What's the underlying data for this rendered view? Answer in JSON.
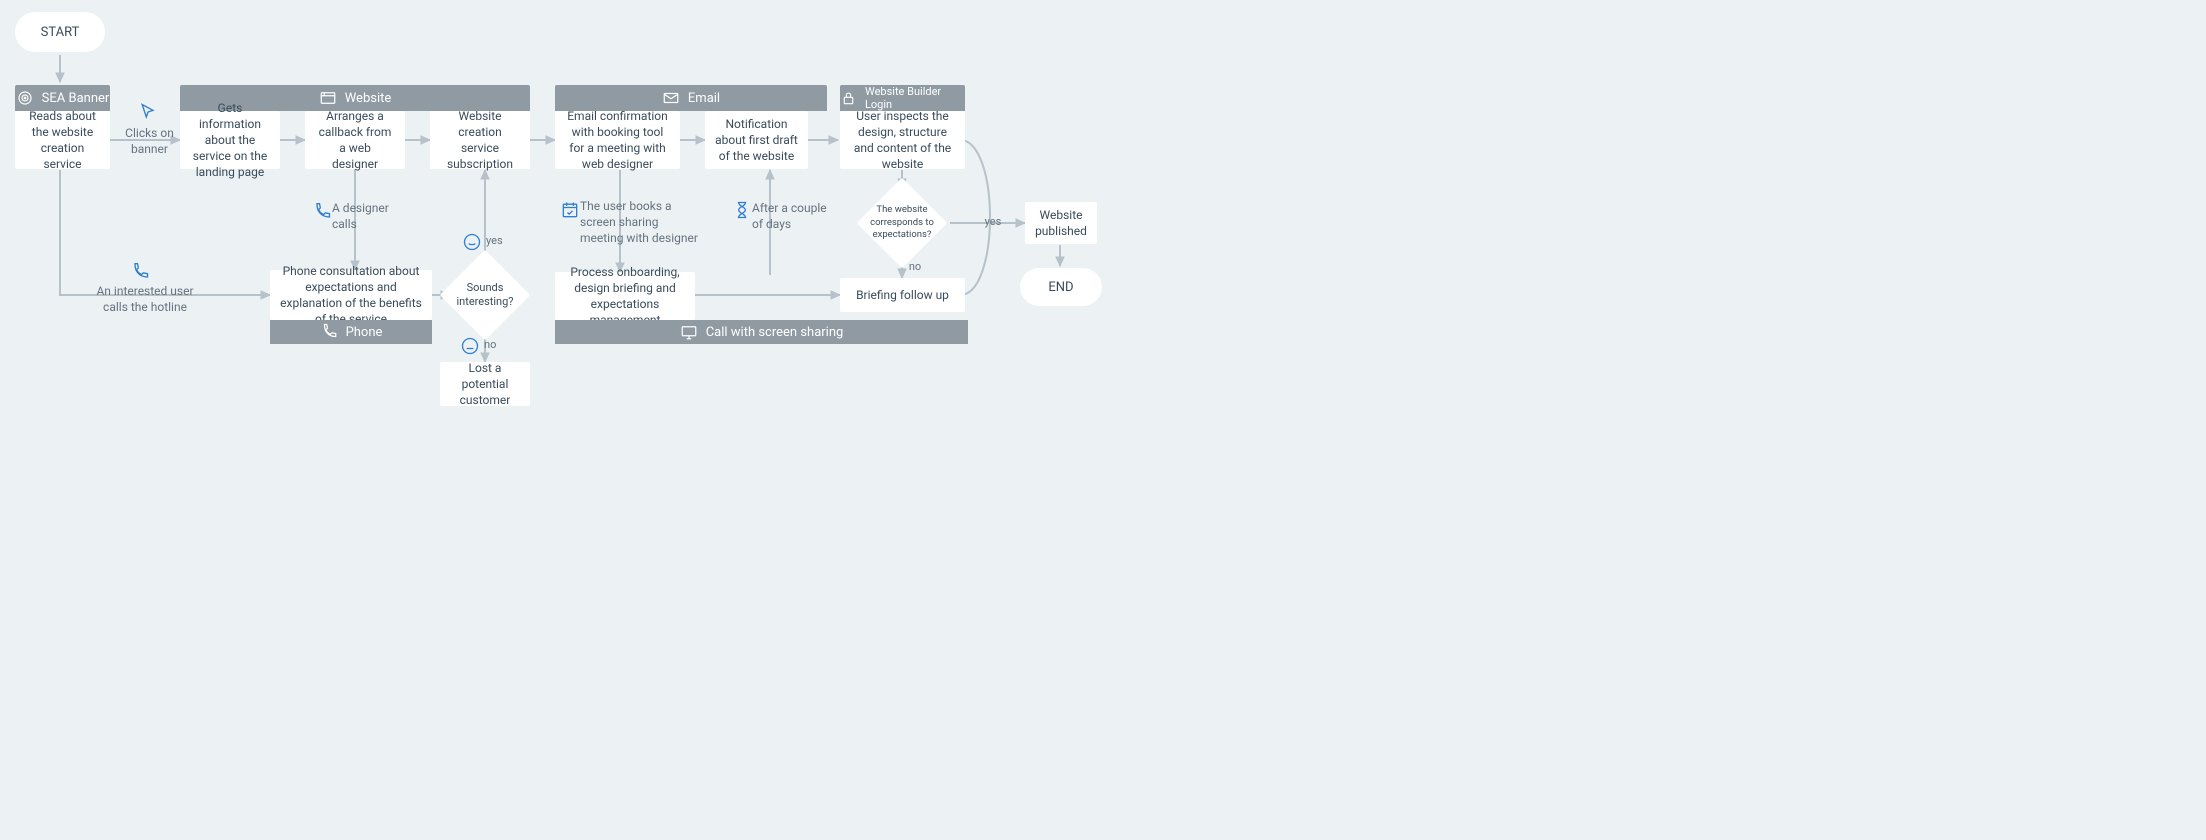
{
  "start": "START",
  "end": "END",
  "headers": {
    "sea": "SEA Banner",
    "website": "Website",
    "email": "Email",
    "login": "Website Builder Login"
  },
  "footers": {
    "phone": "Phone",
    "screen_share": "Call with screen sharing"
  },
  "nodes": {
    "reads_about": "Reads about the website creation service",
    "gets_info": "Gets information about the service on the landing page",
    "arranges_callback": "Arranges a callback from a web designer",
    "subscription": "Website creation service subscription",
    "phone_consult": "Phone consultation about expectations and explanation of the benefits of the service",
    "lost_customer": "Lost a potential customer",
    "email_confirm": "Email confirmation with booking tool for a meeting with web designer",
    "notification_draft": "Notification about first draft of the website",
    "process_onboarding": "Process onboarding, design briefing and expectations management",
    "briefing_followup": "Briefing follow up",
    "user_inspects": "User inspects the design, structure and content of the website",
    "website_published": "Website published"
  },
  "decisions": {
    "sounds_interesting": "Sounds interesting?",
    "matches_expectations": "The website corresponds to expectations?"
  },
  "edge_labels": {
    "clicks_banner": "Clicks on banner",
    "interested_hotline": "An interested user calls the hotline",
    "designer_calls": "A designer calls",
    "yes": "yes",
    "no": "no",
    "user_books": "The user books a screen sharing meeting with designer",
    "after_days": "After a couple of days"
  },
  "icons": {
    "target": "target-icon",
    "browser": "browser-icon",
    "mail": "mail-icon",
    "lock": "lock-icon",
    "cursor": "cursor-icon",
    "phone": "phone-icon",
    "calendar": "calendar-icon",
    "hourglass": "hourglass-icon",
    "smile": "smile-icon",
    "neutral": "neutral-face-icon",
    "monitor": "monitor-icon"
  }
}
